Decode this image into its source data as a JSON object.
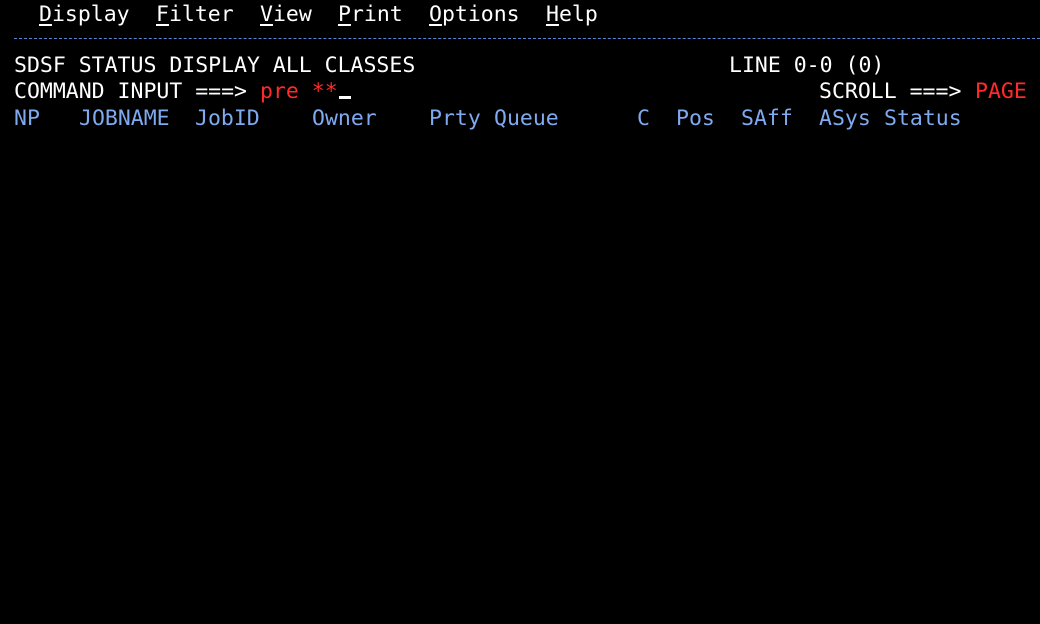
{
  "menu": [
    {
      "hot": "D",
      "rest": "isplay"
    },
    {
      "hot": "F",
      "rest": "ilter"
    },
    {
      "hot": "V",
      "rest": "iew"
    },
    {
      "hot": "P",
      "rest": "rint"
    },
    {
      "hot": "O",
      "rest": "ptions"
    },
    {
      "hot": "H",
      "rest": "elp"
    }
  ],
  "panel": {
    "title": "SDSF STATUS DISPLAY ALL CLASSES",
    "line_info": "LINE 0-0 (0)"
  },
  "command": {
    "label": "COMMAND INPUT ===>",
    "value": "pre **"
  },
  "scroll": {
    "label": "SCROLL ===>",
    "value": "PAGE"
  },
  "columns": [
    "NP",
    "JOBNAME",
    "JobID",
    "Owner",
    "Prty",
    "Queue",
    "C",
    "Pos",
    "SAff",
    "ASys",
    "Status"
  ],
  "colors": {
    "background": "#000000",
    "text": "#ffffff",
    "header_blue": "#7faaf0",
    "input_red": "#ff2a2a",
    "separator": "#5a86d8"
  }
}
